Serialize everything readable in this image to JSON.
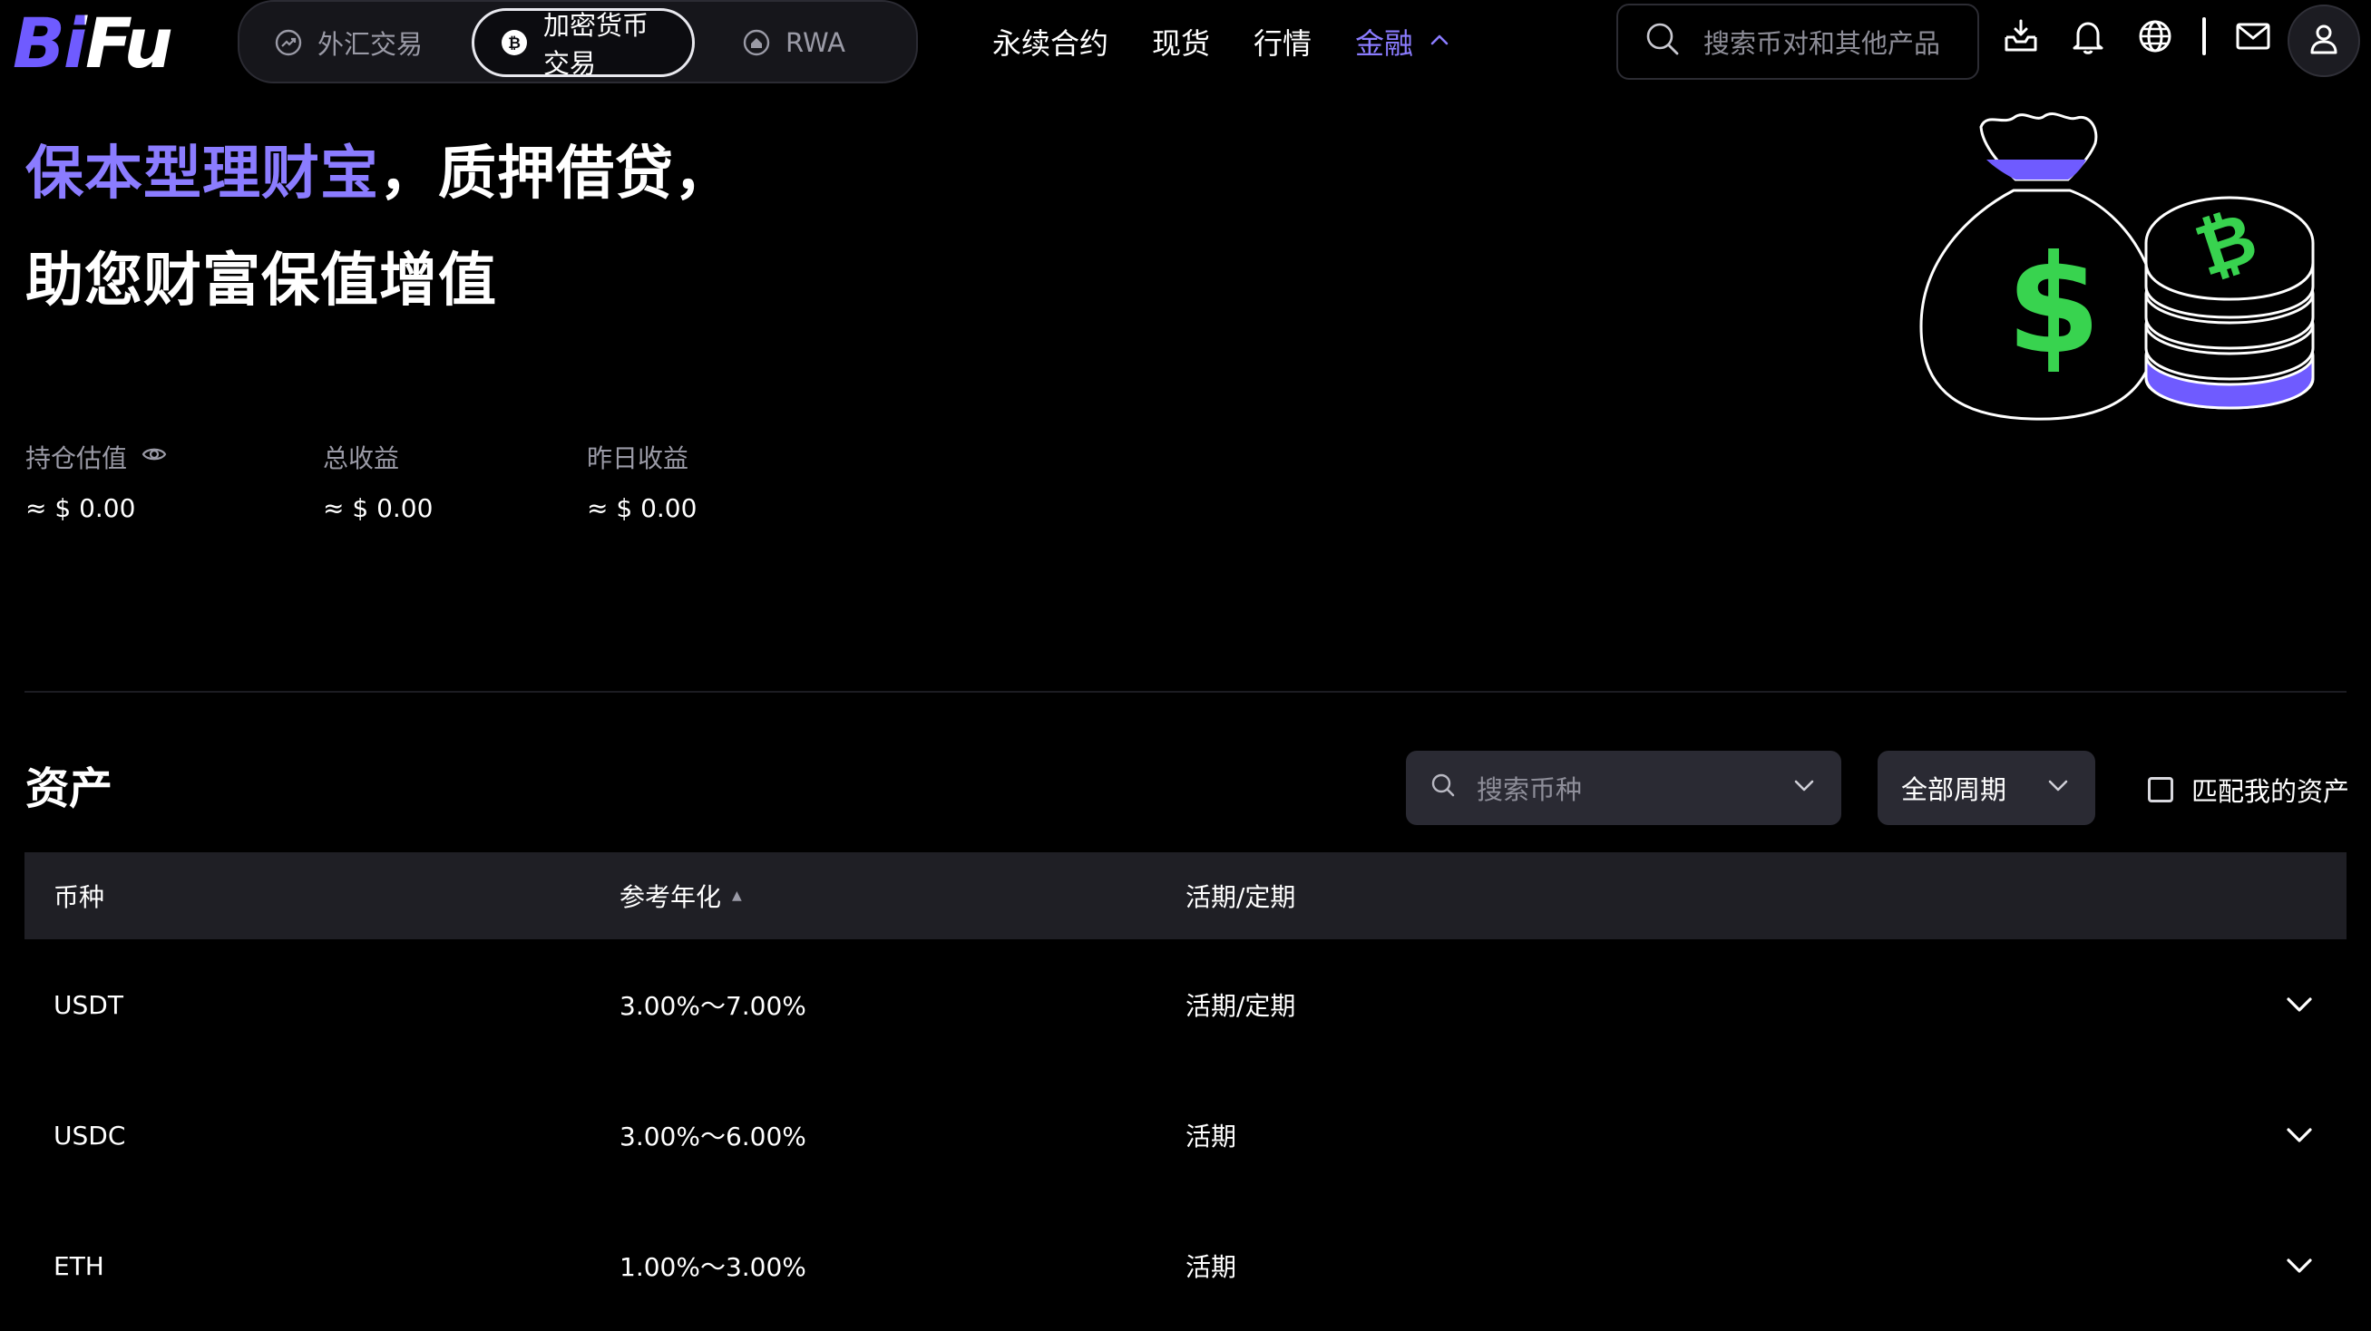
{
  "brand": {
    "name": "BiFu",
    "accent": "#6F5BFF",
    "accent_text": "#8B7CFF",
    "success": "#38D34F"
  },
  "header": {
    "segments": [
      {
        "label": "外汇交易",
        "icon": "trend-icon",
        "active": false
      },
      {
        "label": "加密货币交易",
        "icon": "bitcoin-icon",
        "active": true
      },
      {
        "label": "RWA",
        "icon": "house-icon",
        "active": false
      }
    ],
    "nav": [
      {
        "label": "永续合约"
      },
      {
        "label": "现货"
      },
      {
        "label": "行情"
      },
      {
        "label": "金融",
        "active": true,
        "icon": "chevron-up-icon"
      }
    ],
    "search_placeholder": "搜索币对和其他产品",
    "icons": [
      "download-icon",
      "bell-icon",
      "globe-icon",
      "mail-icon",
      "user-icon"
    ]
  },
  "hero": {
    "title_highlight": "保本型理财宝",
    "title_rest": "，质押借贷，",
    "subtitle": "助您财富保值增值",
    "illustration": "money-bag-and-bitcoin-coins-illustration"
  },
  "stats": [
    {
      "label": "持仓估值",
      "value": "≈ $ 0.00",
      "icon": "eye-icon"
    },
    {
      "label": "总收益",
      "value": "≈ $ 0.00"
    },
    {
      "label": "昨日收益",
      "value": "≈ $ 0.00"
    }
  ],
  "assets": {
    "title": "资产",
    "search_placeholder": "搜索币种",
    "period_selected": "全部周期",
    "match_label": "匹配我的资产",
    "match_checked": false,
    "columns": [
      "币种",
      "参考年化",
      "活期/定期"
    ],
    "sort_indicator": "▲",
    "rows": [
      {
        "coin": "USDT",
        "apr": "3.00%～7.00%",
        "term": "活期/定期"
      },
      {
        "coin": "USDC",
        "apr": "3.00%～6.00%",
        "term": "活期"
      },
      {
        "coin": "ETH",
        "apr": "1.00%～3.00%",
        "term": "活期"
      }
    ]
  }
}
